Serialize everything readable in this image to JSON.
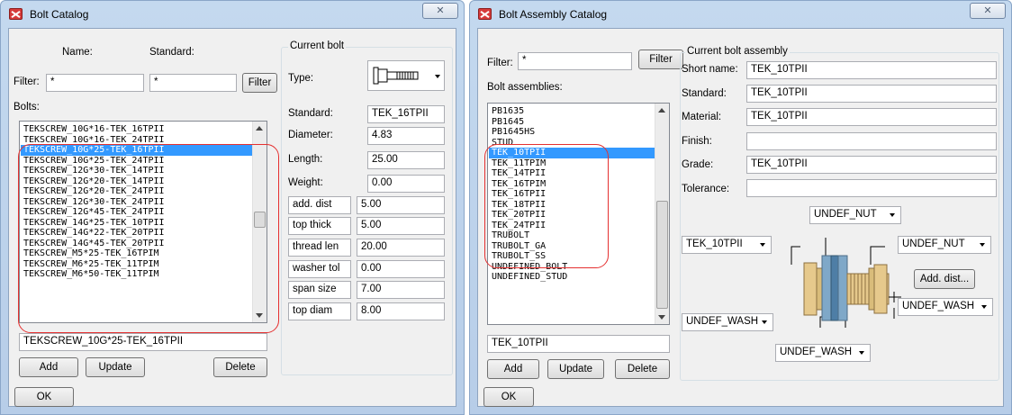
{
  "bolt_catalog": {
    "title": "Bolt Catalog",
    "close_glyph": "✕",
    "name_label": "Name:",
    "standard_label": "Standard:",
    "filter_label": "Filter:",
    "filter_name_value": "*",
    "filter_standard_value": "*",
    "filter_button": "Filter",
    "bolts_label": "Bolts:",
    "bolts": [
      "TEKSCREW_10G*16-TEK_16TPII",
      "TEKSCREW_10G*16-TEK_24TPII",
      "TEKSCREW_10G*25-TEK_16TPII",
      "TEKSCREW_10G*25-TEK_24TPII",
      "TEKSCREW_12G*30-TEK_14TPII",
      "TEKSCREW_12G*20-TEK_14TPII",
      "TEKSCREW_12G*20-TEK_24TPII",
      "TEKSCREW_12G*30-TEK_24TPII",
      "TEKSCREW_12G*45-TEK_24TPII",
      "TEKSCREW_14G*25-TEK_10TPII",
      "TEKSCREW_14G*22-TEK_20TPII",
      "TEKSCREW_14G*45-TEK_20TPII",
      "TEKSCREW_M5*25-TEK_16TPIM",
      "TEKSCREW_M6*25-TEK_11TPIM",
      "TEKSCREW_M6*50-TEK_11TPIM"
    ],
    "selected_bolt": "TEKSCREW_10G*25-TEK_16TPII",
    "add_button": "Add",
    "update_button": "Update",
    "delete_button": "Delete",
    "ok_button": "OK",
    "current_bolt": {
      "caption": "Current bolt",
      "type_label": "Type:",
      "standard_label": "Standard:",
      "standard_value": "TEK_16TPII",
      "diameter_label": "Diameter:",
      "diameter_value": "4.83",
      "length_label": "Length:",
      "length_value": "25.00",
      "weight_label": "Weight:",
      "weight_value": "0.00",
      "add_dist_label": "add. dist",
      "add_dist_value": "5.00",
      "top_thick_label": "top thick",
      "top_thick_value": "5.00",
      "thread_len_label": "thread len",
      "thread_len_value": "20.00",
      "washer_tol_label": "washer tol",
      "washer_tol_value": "0.00",
      "span_size_label": "span size",
      "span_size_value": "7.00",
      "top_diam_label": "top diam",
      "top_diam_value": "8.00"
    }
  },
  "assembly_catalog": {
    "title": "Bolt Assembly Catalog",
    "close_glyph": "✕",
    "filter_label": "Filter:",
    "filter_value": "*",
    "filter_button": "Filter",
    "assemblies_label": "Bolt assemblies:",
    "assemblies": [
      "PB1635",
      "PB1645",
      "PB1645HS",
      "STUD",
      "TEK_10TPII",
      "TEK_11TPIM",
      "TEK_14TPII",
      "TEK_16TPIM",
      "TEK_16TPII",
      "TEK_18TPII",
      "TEK_20TPII",
      "TEK_24TPII",
      "TRUBOLT",
      "TRUBOLT_GA",
      "TRUBOLT_SS",
      "UNDEFINED_BOLT",
      "UNDEFINED_STUD"
    ],
    "selected_assembly": "TEK_10TPII",
    "add_button": "Add",
    "update_button": "Update",
    "delete_button": "Delete",
    "ok_button": "OK",
    "current": {
      "caption": "Current bolt assembly",
      "short_name_label": "Short name:",
      "short_name_value": "TEK_10TPII",
      "standard_label": "Standard:",
      "standard_value": "TEK_10TPII",
      "material_label": "Material:",
      "material_value": "TEK_10TPII",
      "finish_label": "Finish:",
      "finish_value": "",
      "grade_label": "Grade:",
      "grade_value": "TEK_10TPII",
      "tolerance_label": "Tolerance:",
      "tolerance_value": "",
      "top_nut_value": "UNDEF_NUT",
      "bolt_value": "TEK_10TPII",
      "right_nut_value": "UNDEF_NUT",
      "add_dist_button": "Add. dist...",
      "right_washer_value": "UNDEF_WASH",
      "left_washer_value": "UNDEF_WASH",
      "bottom_washer_value": "UNDEF_WASH"
    }
  },
  "colors": {
    "selection": "#3399ff",
    "highlight_ring": "#e53030",
    "title_gradient": "#c4d9ef"
  }
}
